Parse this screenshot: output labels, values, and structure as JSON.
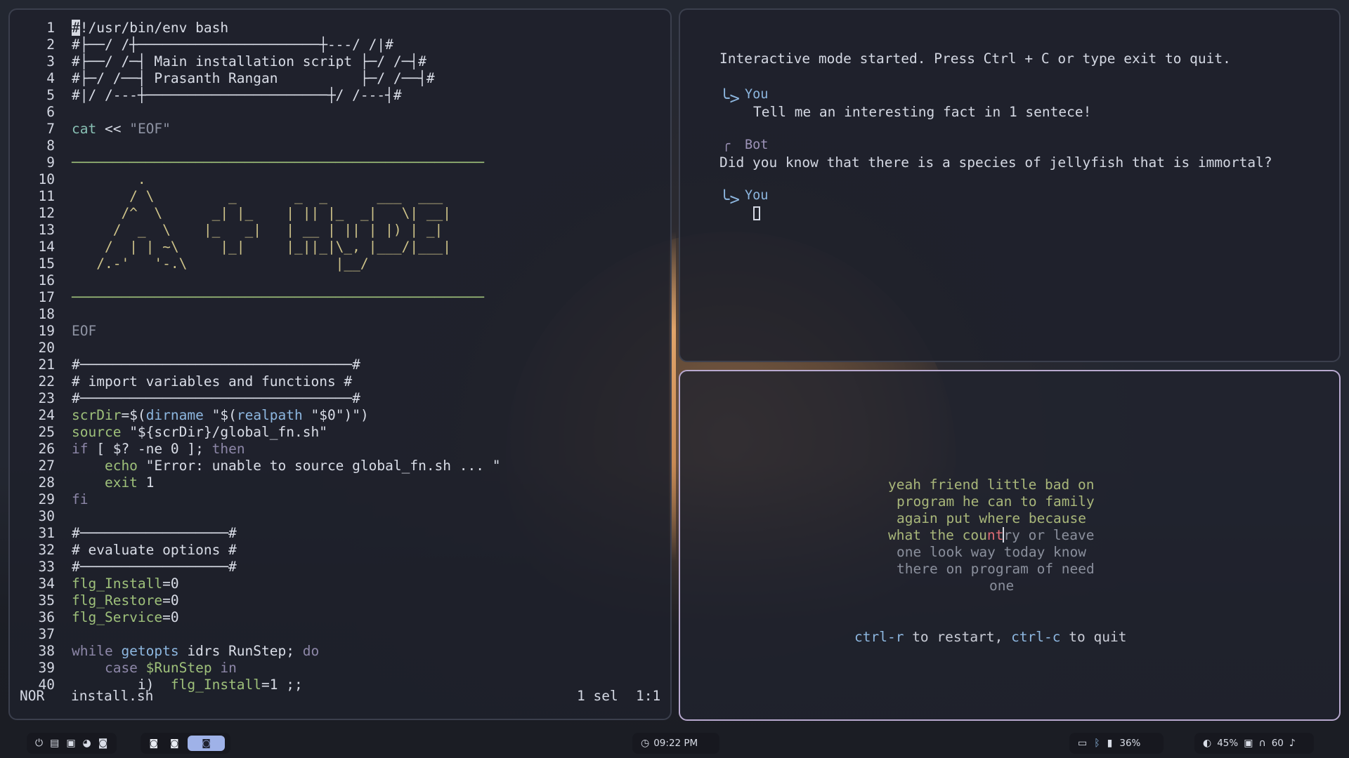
{
  "editor": {
    "lines": [
      {
        "n": "1",
        "segs": [
          {
            "t": "#",
            "c": "cursor-block"
          },
          {
            "t": "!/usr/bin/env bash",
            "c": "c-white"
          }
        ]
      },
      {
        "n": "2",
        "segs": [
          {
            "t": "#├──/ /┼──────────────────────┼---/ /|#",
            "c": "c-white"
          }
        ]
      },
      {
        "n": "3",
        "segs": [
          {
            "t": "#├──/ /─┤ Main installation script ├─/ /─┤#",
            "c": "c-white"
          }
        ]
      },
      {
        "n": "4",
        "segs": [
          {
            "t": "#├─/ /──┤ Prasanth Rangan          ├─/ /──┤#",
            "c": "c-white"
          }
        ]
      },
      {
        "n": "5",
        "segs": [
          {
            "t": "#|/ /---┼──────────────────────┼/ /---┤#",
            "c": "c-white"
          }
        ]
      },
      {
        "n": "6",
        "segs": []
      },
      {
        "n": "7",
        "segs": [
          {
            "t": "cat",
            "c": "c-teal"
          },
          {
            "t": " << ",
            "c": "c-white"
          },
          {
            "t": "\"EOF\"",
            "c": "c-grey"
          }
        ]
      },
      {
        "n": "8",
        "segs": []
      },
      {
        "n": "9",
        "segs": [
          {
            "t": "──────────────────────────────────────────────────",
            "c": "c-green"
          }
        ]
      },
      {
        "n": "10",
        "segs": [
          {
            "t": "        .",
            "c": "c-yellow"
          }
        ]
      },
      {
        "n": "11",
        "segs": [
          {
            "t": "       / \\         _       _  _      ___  ___",
            "c": "c-yellow"
          }
        ]
      },
      {
        "n": "12",
        "segs": [
          {
            "t": "      /^  \\      _| |_    | || |_  _|   \\| __|",
            "c": "c-yellow"
          }
        ]
      },
      {
        "n": "13",
        "segs": [
          {
            "t": "     /  _  \\    |_   _|   | __ | || | |) | _|",
            "c": "c-yellow"
          }
        ]
      },
      {
        "n": "14",
        "segs": [
          {
            "t": "    /  | | ~\\     |_|     |_||_|\\_, |___/|___|",
            "c": "c-yellow"
          }
        ]
      },
      {
        "n": "15",
        "segs": [
          {
            "t": "   /.-'   '-.\\                  |__/",
            "c": "c-yellow"
          }
        ]
      },
      {
        "n": "16",
        "segs": []
      },
      {
        "n": "17",
        "segs": [
          {
            "t": "──────────────────────────────────────────────────",
            "c": "c-green"
          }
        ]
      },
      {
        "n": "18",
        "segs": []
      },
      {
        "n": "19",
        "segs": [
          {
            "t": "EOF",
            "c": "c-grey"
          }
        ]
      },
      {
        "n": "20",
        "segs": []
      },
      {
        "n": "21",
        "segs": [
          {
            "t": "#─────────────────────────────────#",
            "c": "c-white"
          }
        ]
      },
      {
        "n": "22",
        "segs": [
          {
            "t": "# import variables and functions #",
            "c": "c-white"
          }
        ]
      },
      {
        "n": "23",
        "segs": [
          {
            "t": "#─────────────────────────────────#",
            "c": "c-white"
          }
        ]
      },
      {
        "n": "24",
        "segs": [
          {
            "t": "scrDir",
            "c": "c-green"
          },
          {
            "t": "=$(",
            "c": "c-white"
          },
          {
            "t": "dirname",
            "c": "c-blue"
          },
          {
            "t": " \"$(",
            "c": "c-white"
          },
          {
            "t": "realpath",
            "c": "c-blue"
          },
          {
            "t": " \"$0\")\")",
            "c": "c-white"
          }
        ]
      },
      {
        "n": "25",
        "segs": [
          {
            "t": "source",
            "c": "c-green"
          },
          {
            "t": " \"${scrDir}/global_fn.sh\"",
            "c": "c-white"
          }
        ]
      },
      {
        "n": "26",
        "segs": [
          {
            "t": "if",
            "c": "c-purple"
          },
          {
            "t": " [ $? -ne 0 ]; ",
            "c": "c-white"
          },
          {
            "t": "then",
            "c": "c-purple"
          }
        ]
      },
      {
        "n": "27",
        "segs": [
          {
            "t": "    echo",
            "c": "c-green"
          },
          {
            "t": " \"Error: unable to source global_fn.sh ... \"",
            "c": "c-white"
          }
        ]
      },
      {
        "n": "28",
        "segs": [
          {
            "t": "    exit",
            "c": "c-green"
          },
          {
            "t": " 1",
            "c": "c-white"
          }
        ]
      },
      {
        "n": "29",
        "segs": [
          {
            "t": "fi",
            "c": "c-purple"
          }
        ]
      },
      {
        "n": "30",
        "segs": []
      },
      {
        "n": "31",
        "segs": [
          {
            "t": "#──────────────────#",
            "c": "c-white"
          }
        ]
      },
      {
        "n": "32",
        "segs": [
          {
            "t": "# evaluate options #",
            "c": "c-white"
          }
        ]
      },
      {
        "n": "33",
        "segs": [
          {
            "t": "#──────────────────#",
            "c": "c-white"
          }
        ]
      },
      {
        "n": "34",
        "segs": [
          {
            "t": "flg_Install",
            "c": "c-green"
          },
          {
            "t": "=0",
            "c": "c-white"
          }
        ]
      },
      {
        "n": "35",
        "segs": [
          {
            "t": "flg_Restore",
            "c": "c-green"
          },
          {
            "t": "=0",
            "c": "c-white"
          }
        ]
      },
      {
        "n": "36",
        "segs": [
          {
            "t": "flg_Service",
            "c": "c-green"
          },
          {
            "t": "=0",
            "c": "c-white"
          }
        ]
      },
      {
        "n": "37",
        "segs": []
      },
      {
        "n": "38",
        "segs": [
          {
            "t": "while",
            "c": "c-purple"
          },
          {
            "t": " getopts",
            "c": "c-blue"
          },
          {
            "t": " idrs RunStep; ",
            "c": "c-white"
          },
          {
            "t": "do",
            "c": "c-purple"
          }
        ]
      },
      {
        "n": "39",
        "segs": [
          {
            "t": "    case",
            "c": "c-purple"
          },
          {
            "t": " $RunStep",
            "c": "c-green"
          },
          {
            "t": " in",
            "c": "c-purple"
          }
        ]
      },
      {
        "n": "40",
        "segs": [
          {
            "t": "        i)  ",
            "c": "c-white"
          },
          {
            "t": "flg_Install",
            "c": "c-green"
          },
          {
            "t": "=1 ;;",
            "c": "c-white"
          }
        ]
      }
    ],
    "status": {
      "mode": "NOR",
      "file": "install.sh",
      "selection": "1 sel",
      "position": "1:1"
    }
  },
  "chat": {
    "intro": "Interactive mode started. Press Ctrl + C or type exit to quit.",
    "you_label": "You",
    "bot_label": "Bot",
    "user_message": "Tell me an interesting fact in 1 sentece!",
    "bot_message": "Did you know that there is a species of jellyfish that is immortal?"
  },
  "typing_test": {
    "line1": "yeah friend little bad on",
    "line2": "program he can to family",
    "line3": "again put where because",
    "line4_typed": "what the cou",
    "line4_error": "nt",
    "line4_rest": "ry or leave",
    "line5": "one look way today know",
    "line6": "there on program of need",
    "line7": "one",
    "help_key1": "ctrl-r",
    "help_text1": " to restart, ",
    "help_key2": "ctrl-c",
    "help_text2": " to quit"
  },
  "taskbar": {
    "clock": "09:22 PM",
    "battery": "36%",
    "brightness": "45%",
    "volume": "60"
  }
}
